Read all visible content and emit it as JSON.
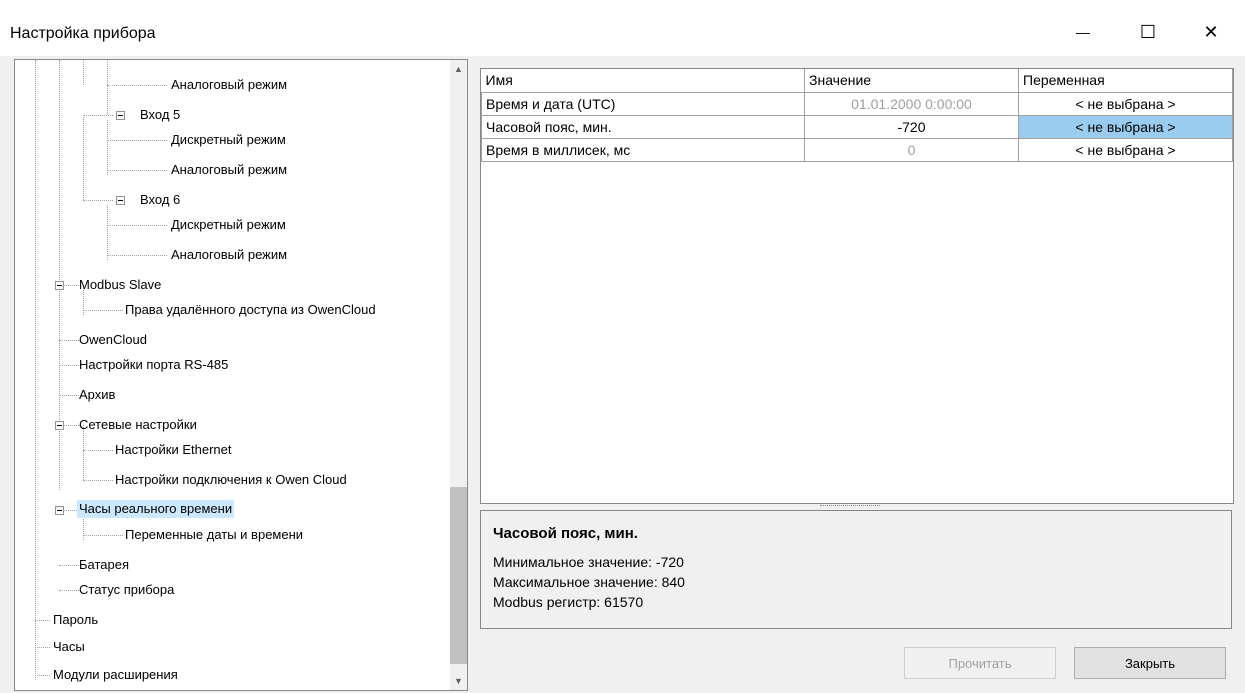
{
  "window": {
    "title": "Настройка прибора",
    "minimize_glyph": "—",
    "maximize_glyph": "☐",
    "close_glyph": "✕"
  },
  "tree": {
    "items": [
      "Аналоговый режим",
      "Вход 5",
      "Дискретный режим",
      "Аналоговый режим",
      "Вход 6",
      "Дискретный режим",
      "Аналоговый режим",
      "Modbus Slave",
      "Права удалённого доступа из OwenCloud",
      "OwenCloud",
      "Настройки порта RS-485",
      "Архив",
      "Сетевые настройки",
      "Настройки Ethernet",
      "Настройки подключения к Owen Cloud",
      "Часы реального времени",
      "Переменные даты и времени",
      "Батарея",
      "Статус прибора",
      "Пароль",
      "Часы",
      "Модули расширения"
    ],
    "selected": "Часы реального времени"
  },
  "grid": {
    "headers": [
      "Имя",
      "Значение",
      "Переменная"
    ],
    "rows": [
      {
        "name": "Время и дата (UTC)",
        "value": "01.01.2000 0:00:00",
        "variable": "< не выбрана >"
      },
      {
        "name": "Часовой пояс, мин.",
        "value": "-720",
        "variable": "< не выбрана >"
      },
      {
        "name": "Время в миллисек, мс",
        "value": "0",
        "variable": "< не выбрана >"
      }
    ]
  },
  "description": {
    "title": "Часовой пояс, мин.",
    "min": "Минимальное значение: -720",
    "max": "Максимальное значение: 840",
    "register": "Modbus регистр: 61570"
  },
  "buttons": {
    "read": "Прочитать",
    "close": "Закрыть"
  },
  "colors": {
    "selection": "#cce8ff",
    "variable_highlight": "#99ccee"
  }
}
